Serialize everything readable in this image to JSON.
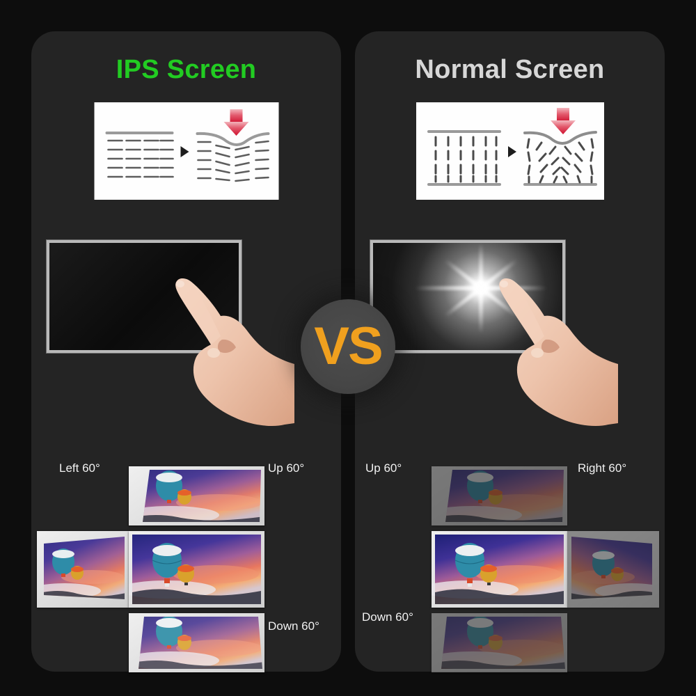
{
  "background_color": "#0d0d0d",
  "panel_color": "#242424",
  "colors": {
    "ips_title": "#22cc22",
    "normal_title": "#d7d7d7",
    "vs_text": "#f0a01e",
    "vs_circle": "#464646",
    "arrow_red": "#d9273e",
    "label_text": "#f1f1f1"
  },
  "panels": [
    {
      "id": "ips",
      "title": "IPS Screen",
      "diagram": {
        "name": "liquid-crystal-pressure-diagram",
        "crystal_orientation": "horizontal",
        "press_arrow": "down-arrow",
        "transition_marker": "play-triangle"
      },
      "touch_demo": {
        "name": "ips-touch-screen",
        "effect": "no-ripple",
        "screen_state": "uniform-dark"
      },
      "angles": {
        "left": "Left 60°",
        "up": "Up 60°",
        "down": "Down 60°",
        "center": "front-view",
        "quality": "high-contrast-all-angles"
      }
    },
    {
      "id": "normal",
      "title": "Normal Screen",
      "diagram": {
        "name": "liquid-crystal-pressure-diagram",
        "crystal_orientation": "vertical",
        "press_arrow": "down-arrow",
        "transition_marker": "play-triangle"
      },
      "touch_demo": {
        "name": "normal-touch-screen",
        "effect": "white-bloom-flare",
        "screen_state": "bright-spot-at-touch"
      },
      "angles": {
        "up": "Up 60°",
        "right": "Right 60°",
        "down": "Down 60°",
        "center": "front-view",
        "quality": "washed-out-off-axis"
      }
    }
  ],
  "vs_badge": {
    "label": "VS",
    "name": "versus-badge"
  },
  "image_subject": "hot-air-balloons-at-sunset"
}
